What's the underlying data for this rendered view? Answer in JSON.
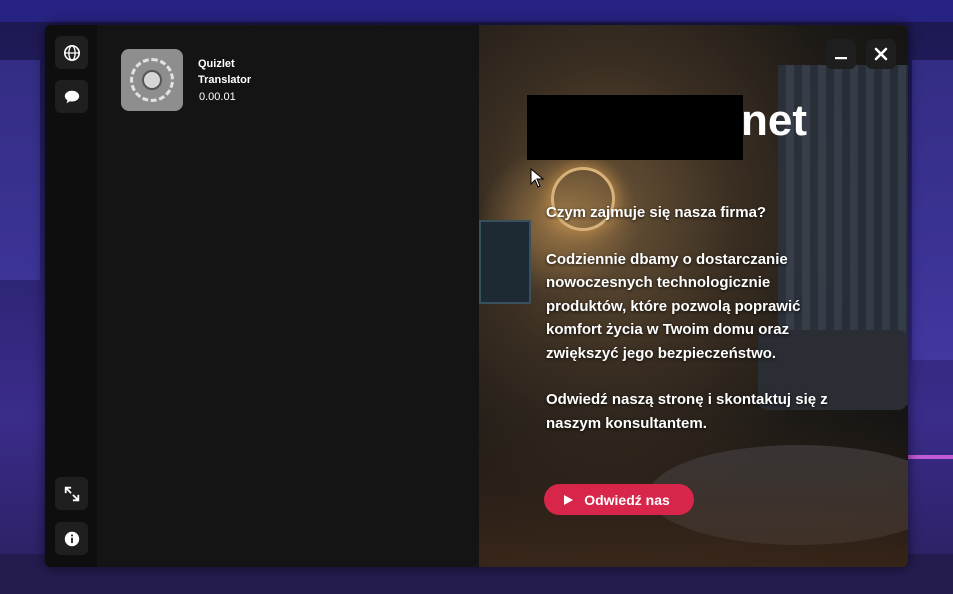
{
  "colors": {
    "window_bg": "#131313",
    "sidebar_bg": "#0e0e0e",
    "button_bg": "#1f1f1f",
    "cta_bg": "#d8254a",
    "text": "#ffffff"
  },
  "sidebar": {
    "top_buttons": [
      {
        "icon": "globe-icon"
      },
      {
        "icon": "chat-icon"
      }
    ],
    "bottom_buttons": [
      {
        "icon": "expand-icon"
      },
      {
        "icon": "info-icon"
      }
    ]
  },
  "app_card": {
    "icon": "app-logo-icon",
    "name_line1": "Quizlet",
    "name_line2": "Translator",
    "version": "0.00.01"
  },
  "promo": {
    "brand_visible": "net",
    "window_controls": {
      "minimize": "minimize-icon",
      "close": "close-icon"
    },
    "heading": "Czym zajmuje się nasza firma?",
    "paragraph1": "Codziennie dbamy o dostarczanie nowoczesnych technologicznie produktów, które pozwolą poprawić komfort życia w Twoim domu oraz zwiększyć jego bezpieczeństwo.",
    "paragraph2": "Odwiedź naszą stronę i skontaktuj się z naszym konsultantem.",
    "cta_label": "Odwiedź nas",
    "cta_icon": "play-icon"
  }
}
